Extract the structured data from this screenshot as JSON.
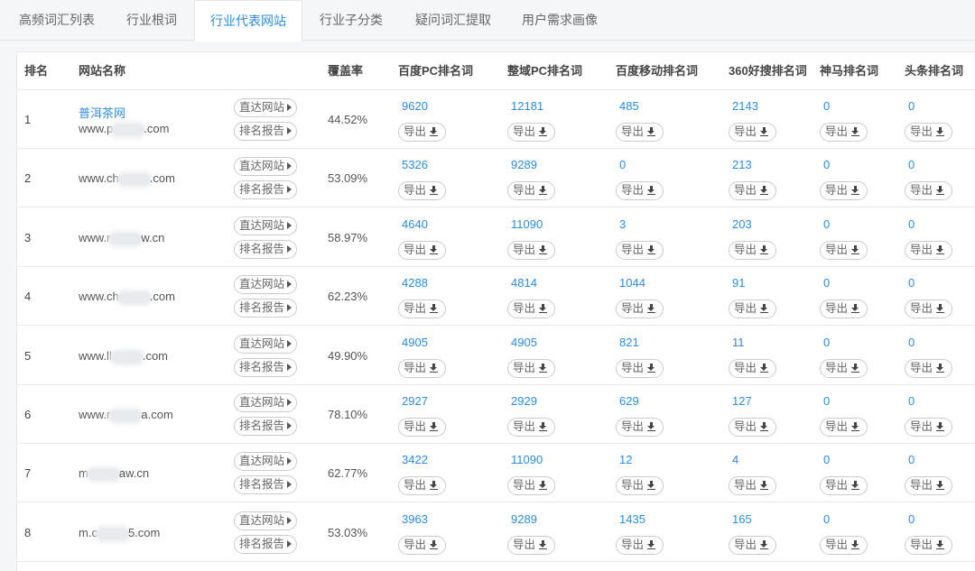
{
  "tabs": [
    {
      "label": "高频词汇列表",
      "active": false
    },
    {
      "label": "行业根词",
      "active": false
    },
    {
      "label": "行业代表网站",
      "active": true
    },
    {
      "label": "行业子分类",
      "active": false
    },
    {
      "label": "疑问词汇提取",
      "active": false
    },
    {
      "label": "用户需求画像",
      "active": false
    }
  ],
  "table": {
    "headers": {
      "rank": "排名",
      "site": "网站名称",
      "coverage": "覆盖率",
      "baidu_pc": "百度PC排名词",
      "whole_pc": "整域PC排名词",
      "baidu_mobile": "百度移动排名词",
      "so360": "360好搜排名词",
      "shenma": "神马排名词",
      "toutiao": "头条排名词"
    },
    "labels": {
      "visit": "直达网站",
      "report": "排名报告",
      "export": "导出"
    },
    "rows": [
      {
        "rank": "1",
        "name": "普洱茶网",
        "url_pre": "www.p",
        "url_post": ".com",
        "coverage": "44.52%",
        "baidu_pc": "9620",
        "whole_pc": "12181",
        "baidu_mobile": "485",
        "so360": "2143",
        "shenma": "0",
        "toutiao": "0"
      },
      {
        "rank": "2",
        "name": "",
        "url_pre": "www.ch",
        "url_post": ".com",
        "coverage": "53.09%",
        "baidu_pc": "5326",
        "whole_pc": "9289",
        "baidu_mobile": "0",
        "so360": "213",
        "shenma": "0",
        "toutiao": "0"
      },
      {
        "rank": "3",
        "name": "",
        "url_pre": "www.r",
        "url_post": "w.cn",
        "coverage": "58.97%",
        "baidu_pc": "4640",
        "whole_pc": "11090",
        "baidu_mobile": "3",
        "so360": "203",
        "shenma": "0",
        "toutiao": "0"
      },
      {
        "rank": "4",
        "name": "",
        "url_pre": "www.ch",
        "url_post": ".com",
        "coverage": "62.23%",
        "baidu_pc": "4288",
        "whole_pc": "4814",
        "baidu_mobile": "1044",
        "so360": "91",
        "shenma": "0",
        "toutiao": "0"
      },
      {
        "rank": "5",
        "name": "",
        "url_pre": "www.ll",
        "url_post": ".com",
        "coverage": "49.90%",
        "baidu_pc": "4905",
        "whole_pc": "4905",
        "baidu_mobile": "821",
        "so360": "11",
        "shenma": "0",
        "toutiao": "0"
      },
      {
        "rank": "6",
        "name": "",
        "url_pre": "www.r",
        "url_post": "a.com",
        "coverage": "78.10%",
        "baidu_pc": "2927",
        "whole_pc": "2929",
        "baidu_mobile": "629",
        "so360": "127",
        "shenma": "0",
        "toutiao": "0"
      },
      {
        "rank": "7",
        "name": "",
        "url_pre": "m",
        "url_post": "aw.cn",
        "coverage": "62.77%",
        "baidu_pc": "3422",
        "whole_pc": "11090",
        "baidu_mobile": "12",
        "so360": "4",
        "shenma": "0",
        "toutiao": "0"
      },
      {
        "rank": "8",
        "name": "",
        "url_pre": "m.c",
        "url_post": "5.com",
        "coverage": "53.03%",
        "baidu_pc": "3963",
        "whole_pc": "9289",
        "baidu_mobile": "1435",
        "so360": "165",
        "shenma": "0",
        "toutiao": "0"
      }
    ]
  }
}
